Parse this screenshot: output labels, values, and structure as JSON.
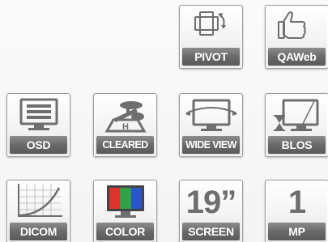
{
  "tiles": [
    {
      "id": "pivot",
      "label": "PIVOT",
      "icon": "pivot-rotate-icon"
    },
    {
      "id": "qaweb",
      "label": "QAWeb",
      "icon": "thumbs-up-icon"
    },
    {
      "id": "osd",
      "label": "OSD",
      "icon": "monitor-menu-icon"
    },
    {
      "id": "cleared",
      "label": "CLEARED",
      "icon": "helipad-icon"
    },
    {
      "id": "wide-view",
      "label": "WIDE VIEW",
      "icon": "wide-angle-monitor-icon"
    },
    {
      "id": "blos",
      "label": "BLOS",
      "icon": "hourglass-monitor-icon"
    },
    {
      "id": "dicom",
      "label": "DICOM",
      "icon": "curve-graph-icon"
    },
    {
      "id": "color",
      "label": "COLOR",
      "icon": "rgb-monitor-icon"
    },
    {
      "id": "screen",
      "label": "SCREEN",
      "big_text": "19”"
    },
    {
      "id": "mp",
      "label": "MP",
      "big_text": "1"
    }
  ],
  "colors": {
    "label_bg": "#6a6a6a",
    "icon_gray": "#6e6e6e",
    "rgb_red": "#e0322d",
    "rgb_green": "#33a047",
    "rgb_blue": "#2b56c9"
  }
}
